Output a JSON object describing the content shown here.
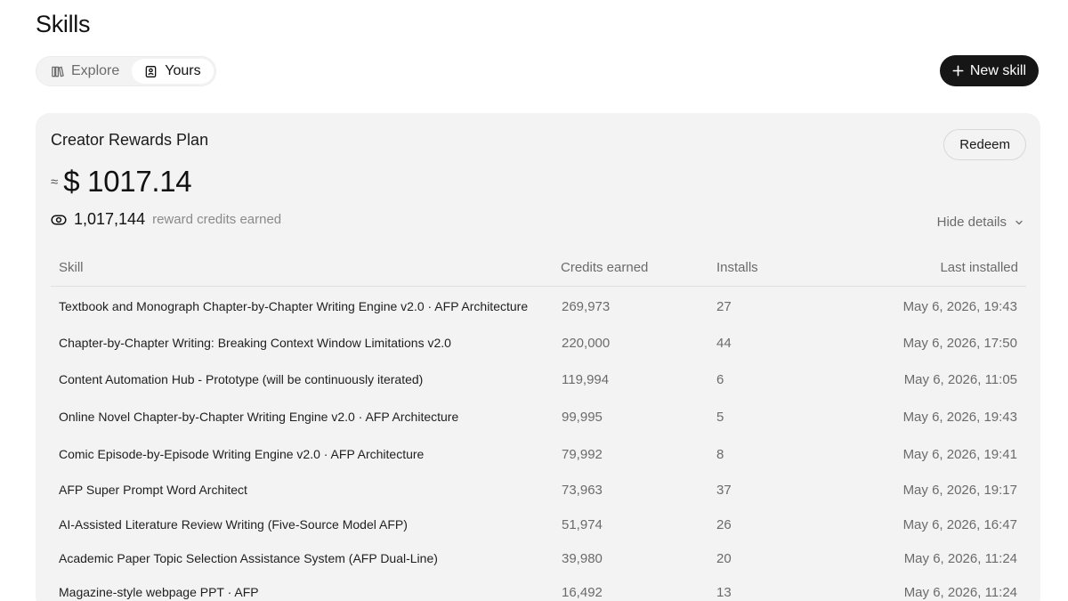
{
  "header": {
    "title": "Skills"
  },
  "tabs": [
    {
      "label": "Explore",
      "icon": "book-icon",
      "active": false
    },
    {
      "label": "Yours",
      "icon": "skill-card-icon",
      "active": true
    }
  ],
  "actions": {
    "new_skill_label": "New skill"
  },
  "rewards": {
    "title": "Creator Rewards Plan",
    "redeem_label": "Redeem",
    "approx_symbol": "≈",
    "amount": "$ 1017.14",
    "credits_value": "1,017,144",
    "credits_label": "reward credits earned",
    "hide_details_label": "Hide details"
  },
  "table": {
    "columns": [
      "Skill",
      "Credits earned",
      "Installs",
      "Last installed"
    ],
    "rows": [
      {
        "skill": "Textbook and Monograph Chapter-by-Chapter Writing Engine v2.0 · AFP Architecture",
        "credits": "269,973",
        "installs": "27",
        "last": "May 6, 2026, 19:43"
      },
      {
        "skill": "Chapter-by-Chapter Writing: Breaking Context Window Limitations v2.0",
        "credits": "220,000",
        "installs": "44",
        "last": "May 6, 2026, 17:50"
      },
      {
        "skill": "Content Automation Hub - Prototype (will be continuously iterated)",
        "credits": "119,994",
        "installs": "6",
        "last": "May 6, 2026, 11:05"
      },
      {
        "skill": "Online Novel Chapter-by-Chapter Writing Engine v2.0 · AFP Architecture",
        "credits": "99,995",
        "installs": "5",
        "last": "May 6, 2026, 19:43"
      },
      {
        "skill": "Comic Episode-by-Episode Writing Engine v2.0 · AFP Architecture",
        "credits": "79,992",
        "installs": "8",
        "last": "May 6, 2026, 19:41"
      },
      {
        "skill": "AFP Super Prompt Word Architect",
        "credits": "73,963",
        "installs": "37",
        "last": "May 6, 2026, 19:17"
      },
      {
        "skill": "AI-Assisted Literature Review Writing (Five-Source Model AFP)",
        "credits": "51,974",
        "installs": "26",
        "last": "May 6, 2026, 16:47"
      },
      {
        "skill": "Academic Paper Topic Selection Assistance System (AFP Dual-Line)",
        "credits": "39,980",
        "installs": "20",
        "last": "May 6, 2026, 11:24"
      },
      {
        "skill": "Magazine-style webpage PPT · AFP",
        "credits": "16,492",
        "installs": "13",
        "last": "May 6, 2026, 11:24"
      }
    ]
  }
}
